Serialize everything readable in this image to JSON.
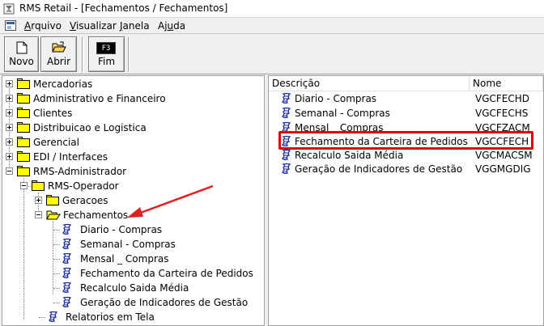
{
  "window": {
    "title": "RMS Retail - [Fechamentos / Fechamentos]"
  },
  "menu": [
    {
      "label": "Arquivo",
      "mnemonic": "A"
    },
    {
      "label": "Visualizar",
      "mnemonic": "V"
    },
    {
      "label": "Janela",
      "mnemonic": "J"
    },
    {
      "label": "Ajuda",
      "mnemonic": "u"
    }
  ],
  "toolbar": {
    "novo_label": "Novo",
    "abrir_label": "Abrir",
    "fim_label": "Fim",
    "fim_key": "F3"
  },
  "tree": {
    "items": [
      {
        "label": "Mercadorias",
        "level": 0,
        "type": "folder",
        "expander": "plus"
      },
      {
        "label": "Administrativo e Financeiro",
        "level": 0,
        "type": "folder",
        "expander": "plus"
      },
      {
        "label": "Clientes",
        "level": 0,
        "type": "folder",
        "expander": "plus"
      },
      {
        "label": "Distribuicao e Logistica",
        "level": 0,
        "type": "folder",
        "expander": "plus"
      },
      {
        "label": "Gerencial",
        "level": 0,
        "type": "folder",
        "expander": "plus"
      },
      {
        "label": "EDI / Interfaces",
        "level": 0,
        "type": "folder",
        "expander": "plus"
      },
      {
        "label": "RMS-Administrador",
        "level": 0,
        "type": "folder",
        "expander": "minus"
      },
      {
        "label": "RMS-Operador",
        "level": 1,
        "type": "folder",
        "expander": "minus"
      },
      {
        "label": "Geracoes",
        "level": 2,
        "type": "folder",
        "expander": "plus"
      },
      {
        "label": "Fechamentos",
        "level": 2,
        "type": "folder-open",
        "expander": "minus"
      },
      {
        "label": "Diario - Compras",
        "level": 3,
        "type": "program"
      },
      {
        "label": "Semanal - Compras",
        "level": 3,
        "type": "program"
      },
      {
        "label": "Mensal _ Compras",
        "level": 3,
        "type": "program"
      },
      {
        "label": "Fechamento da Carteira de Pedidos",
        "level": 3,
        "type": "program"
      },
      {
        "label": "Recalculo Saida Média",
        "level": 3,
        "type": "program"
      },
      {
        "label": "Geração de Indicadores de Gestão",
        "level": 3,
        "type": "program"
      },
      {
        "label": "Relatorios em Tela",
        "level": 1,
        "type": "program"
      }
    ]
  },
  "list": {
    "columns": [
      "Descrição",
      "Nome"
    ],
    "rows": [
      {
        "description": "Diario - Compras",
        "name": "VGCFECHD"
      },
      {
        "description": "Semanal - Compras",
        "name": "VGCFECHS"
      },
      {
        "description": "Mensal _ Compras",
        "name": "VGCFZACM"
      },
      {
        "description": "Fechamento da Carteira de Pedidos",
        "name": "VGCCFECH"
      },
      {
        "description": "Recalculo Saida Média",
        "name": "VGCMACSM"
      },
      {
        "description": "Geração de Indicadores de Gestão",
        "name": "VGGMGDIG"
      }
    ]
  },
  "annotations": {
    "highlight_color": "#e00000",
    "arrow_color": "#e02020"
  },
  "icons": {
    "app": "rms-app-icon",
    "program": "program-script-icon",
    "folder": "folder-icon",
    "open_folder": "open-folder-icon"
  }
}
